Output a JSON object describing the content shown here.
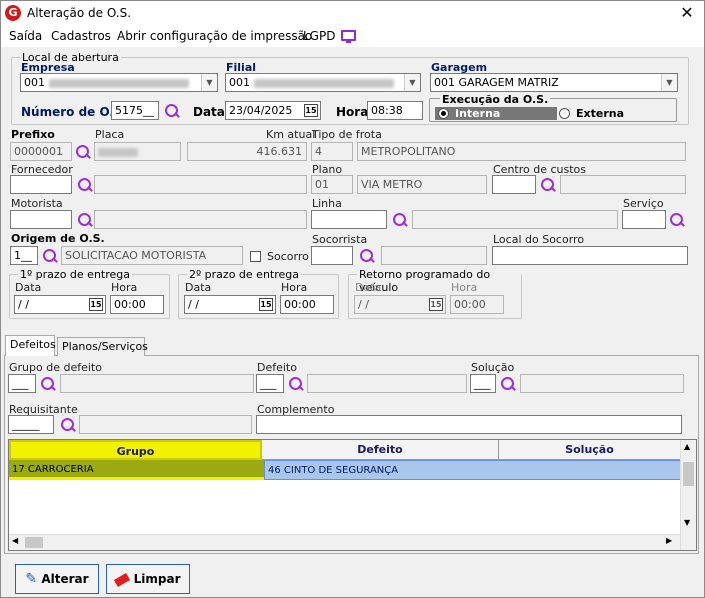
{
  "window": {
    "title": "Alteração de O.S.",
    "close": "✕",
    "app_icon": "G"
  },
  "menu": [
    "Saída",
    "Cadastros",
    "Abrir configuração de impressão",
    "LGPD"
  ],
  "local": {
    "group_title": "Local de abertura",
    "empresa_label": "Empresa",
    "empresa_value": "001",
    "filial_label": "Filial",
    "filial_value": "001",
    "garagem_label": "Garagem",
    "garagem_value": "001 GARAGEM MATRIZ",
    "numero_label": "Número de O.S.",
    "numero_value": "5175__",
    "data_label": "Data",
    "data_value": "23/04/2025",
    "hora_label": "Hora",
    "hora_value": "08:38",
    "execucao_title": "Execução da O.S.",
    "interna": "Interna",
    "externa": "Externa"
  },
  "vehicle": {
    "prefixo_label": "Prefixo",
    "prefixo_value": "0000001",
    "placa_label": "Placa",
    "km_label": "Km atual",
    "km_value": "416.631",
    "tipo_label": "Tipo de frota",
    "tipo_code": "4",
    "tipo_value": "METROPOLITANO",
    "fornecedor_label": "Fornecedor",
    "plano_label": "Plano",
    "plano_code": "01",
    "plano_value": "VIA METRO",
    "centro_label": "Centro de custos",
    "motorista_label": "Motorista",
    "linha_label": "Linha",
    "servico_label": "Serviço",
    "origem_label": "Origem de O.S.",
    "origem_code": "1__",
    "origem_value": "SOLICITACAO MOTORISTA",
    "socorro_label": "Socorro",
    "socorrista_label": "Socorrista",
    "local_socorro_label": "Local do Socorro"
  },
  "prazos": {
    "p1_title": "1º prazo de entrega",
    "p2_title": "2º prazo de entrega",
    "p3_title": "Retorno programado do veículo",
    "data_label": "Data",
    "hora_label": "Hora",
    "data_value": " / /",
    "hora_value": "00:00",
    "cal": "15"
  },
  "tabs": [
    "Defeitos",
    "Planos/Serviços"
  ],
  "defeitos": {
    "grupo_label": "Grupo de defeito",
    "grupo_value": "___",
    "defeito_label": "Defeito",
    "defeito_value": "___",
    "solucao_label": "Solução",
    "solucao_value": "___",
    "requisitante_label": "Requisitante",
    "requisitante_value": "_____",
    "complemento_label": "Complemento"
  },
  "grid": {
    "columns": [
      "Grupo",
      "Defeito",
      "Solução"
    ],
    "rows": [
      {
        "grupo": "17 CARROCERIA",
        "defeito": "46 CINTO DE SEGURANÇA",
        "solucao": ""
      }
    ]
  },
  "buttons": {
    "alterar": "Alterar",
    "limpar": "Limpar"
  },
  "colors": {
    "highlight": "#f2f200",
    "selected_row": "#a9c6ec",
    "accent": "#9b30d6"
  }
}
